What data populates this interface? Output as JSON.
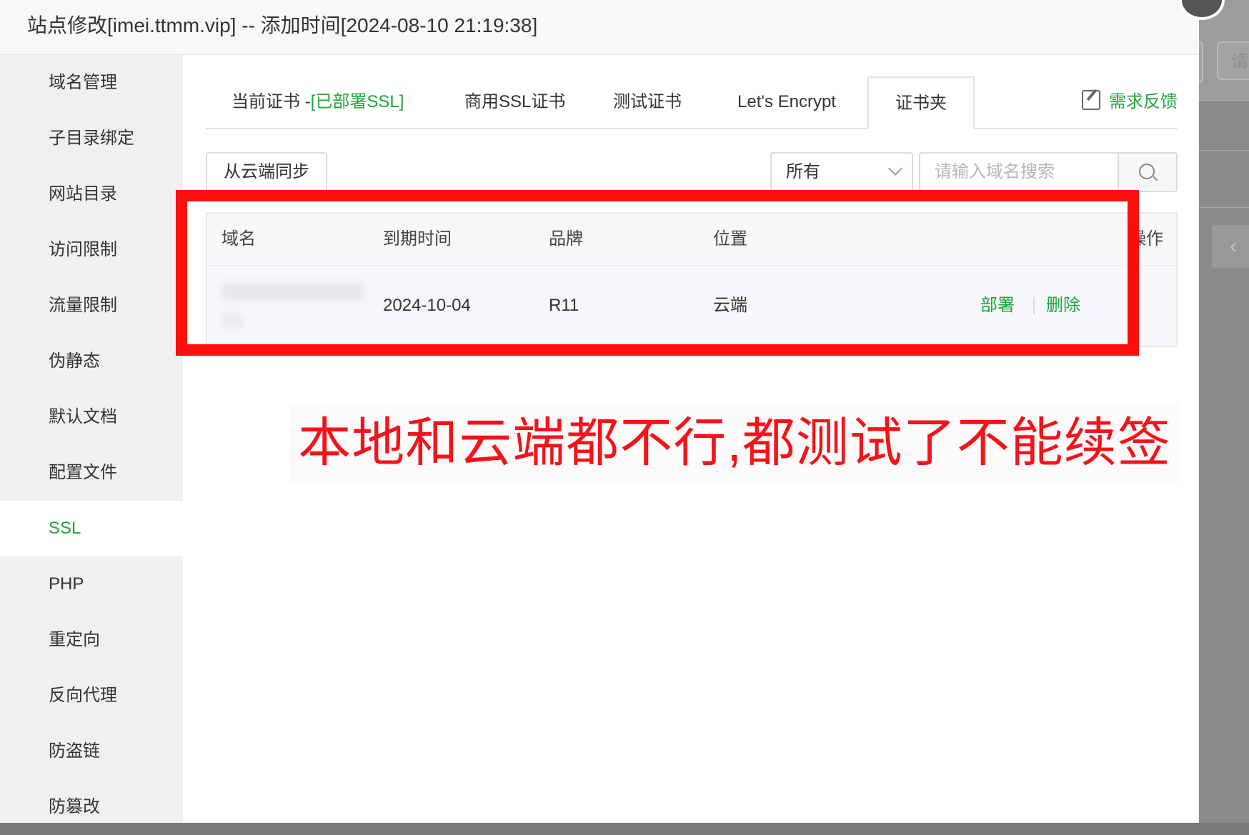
{
  "window": {
    "title": "站点修改[imei.ttmm.vip] -- 添加时间[2024-08-10 21:19:38]"
  },
  "background": {
    "button_text": "请"
  },
  "sidebar": {
    "items": [
      {
        "label": "域名管理"
      },
      {
        "label": "子目录绑定"
      },
      {
        "label": "网站目录"
      },
      {
        "label": "访问限制"
      },
      {
        "label": "流量限制"
      },
      {
        "label": "伪静态"
      },
      {
        "label": "默认文档"
      },
      {
        "label": "配置文件"
      },
      {
        "label": "SSL",
        "active": true
      },
      {
        "label": "PHP"
      },
      {
        "label": "重定向"
      },
      {
        "label": "反向代理"
      },
      {
        "label": "防盗链"
      },
      {
        "label": "防篡改"
      }
    ]
  },
  "tabs": {
    "current_prefix": "当前证书 -",
    "current_status": "[已部署SSL]",
    "commercial": "商用SSL证书",
    "test": "测试证书",
    "letsencrypt": "Let's Encrypt",
    "folder": "证书夹",
    "active": "证书夹",
    "feedback": "需求反馈"
  },
  "toolbar": {
    "sync_button": "从云端同步",
    "filter_selected": "所有",
    "search_placeholder": "请输入域名搜索"
  },
  "table": {
    "headers": {
      "domain": "域名",
      "expire": "到期时间",
      "brand": "品牌",
      "location": "位置",
      "actions": "操作"
    },
    "rows": [
      {
        "domain": "",
        "expire": "2024-10-04",
        "brand": "R11",
        "location": "云端",
        "action_deploy": "部署",
        "action_delete": "删除"
      }
    ]
  },
  "annotation": {
    "text": "本地和云端都不行,都测试了不能续签",
    "color": "#f2141a"
  },
  "colors": {
    "accent": "#20a53a",
    "highlight": "#ff0e0e"
  }
}
